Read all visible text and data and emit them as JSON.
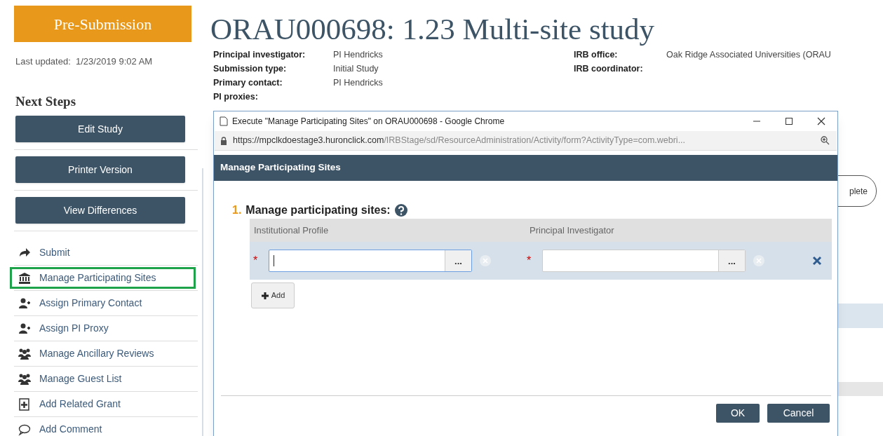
{
  "sidebar": {
    "status_badge": "Pre-Submission",
    "last_updated": "Last updated:  1/23/2019 9:02 AM",
    "next_steps_heading": "Next Steps",
    "buttons": [
      "Edit Study",
      "Printer Version",
      "View Differences"
    ],
    "actions": [
      {
        "kind": "arrow",
        "label": "Submit",
        "highlighted": false
      },
      {
        "kind": "bank",
        "label": "Manage Participating Sites",
        "highlighted": true
      },
      {
        "kind": "user-plus",
        "label": "Assign Primary Contact",
        "highlighted": false
      },
      {
        "kind": "user-plus",
        "label": "Assign PI Proxy",
        "highlighted": false
      },
      {
        "kind": "group",
        "label": "Manage Ancillary Reviews",
        "highlighted": false
      },
      {
        "kind": "group",
        "label": "Manage Guest List",
        "highlighted": false
      },
      {
        "kind": "doc-plus",
        "label": "Add Related Grant",
        "highlighted": false
      },
      {
        "kind": "comment",
        "label": "Add Comment",
        "highlighted": false
      }
    ]
  },
  "study": {
    "title": "ORAU000698: 1.23 Multi-site study",
    "details_left": [
      {
        "label": "Principal investigator:",
        "value": "PI Hendricks"
      },
      {
        "label": "Submission type:",
        "value": "Initial Study"
      },
      {
        "label": "Primary contact:",
        "value": "PI Hendricks"
      },
      {
        "label": "PI proxies:"
      }
    ],
    "details_right": [
      {
        "label": "IRB office:",
        "value": "Oak Ridge Associated Universities (ORAU"
      },
      {
        "label": "IRB coordinator:"
      }
    ],
    "background_button": "plete"
  },
  "popup": {
    "window_title": "Execute \"Manage Participating Sites\" on ORAU000698 - Google Chrome",
    "url_domain": "https://mpclkdoestage3.huronclick.com",
    "url_path": "/IRBStage/sd/ResourceAdministration/Activity/form?ActivityType=com.webri...",
    "dialog_title": "Manage Participating Sites",
    "question_number": "1.",
    "question": "Manage participating sites:",
    "columns": [
      "Institutional Profile",
      "Principal Investigator"
    ],
    "rows": [
      {
        "fields": [
          {
            "required_mark": "*",
            "focused": true,
            "browse": "..."
          },
          {
            "required_mark": "*",
            "focused": false,
            "browse": "..."
          }
        ]
      }
    ],
    "add_button": "Add",
    "ok_button": "OK",
    "cancel_button": "Cancel"
  }
}
